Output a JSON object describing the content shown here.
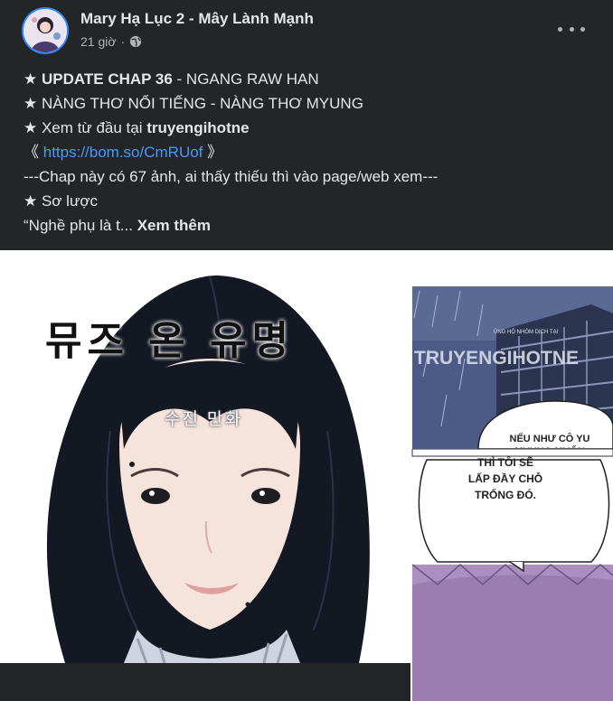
{
  "post": {
    "author": "Mary Hạ Lục 2 - Mây Lành Mạnh",
    "time": "21 giờ",
    "separator": "·",
    "privacy_icon": "globe-icon",
    "more_icon": "more-horizontal-icon"
  },
  "content": {
    "line1_star": "★ ",
    "line1_bold": "UPDATE CHAP 36",
    "line1_rest": " - NGANG RAW HAN",
    "line2": "★ NÀNG THƠ NỔI TIẾNG - NÀNG THƠ MYUNG",
    "line3_prefix": "★ Xem từ đầu tại ",
    "line3_bold": "truyengihotne",
    "line4_open": "《 ",
    "line4_link": "https://bom.so/CmRUof",
    "line4_close": " 》",
    "line5": "---Chap này có 67 ảnh, ai thấy thiếu thì vào page/web xem---",
    "line6": "★ Sơ lược",
    "line7_text": "“Nghề phụ là t... ",
    "line7_more": "Xem thêm"
  },
  "image_left": {
    "title_korean": "뮤즈 온 유명",
    "subtitle_korean": "수진 만화"
  },
  "image_right_top": {
    "watermark_small": "ỦNG HỘ NHÓM DỊCH TẠI",
    "watermark": "TRUYENGIHOTNE",
    "bubble1": "NẾU NHƯ CÔ YU MYUNG MUỐN"
  },
  "image_right_bottom": {
    "bubble2_line1": "THÌ TÔI SẼ",
    "bubble2_line2": "LẤP ĐẦY CHỖ",
    "bubble2_line3": "TRỐNG ĐÓ."
  },
  "colors": {
    "background": "#242526",
    "text": "#e4e6eb",
    "secondary_text": "#b0b3b8",
    "link": "#4599ff"
  }
}
